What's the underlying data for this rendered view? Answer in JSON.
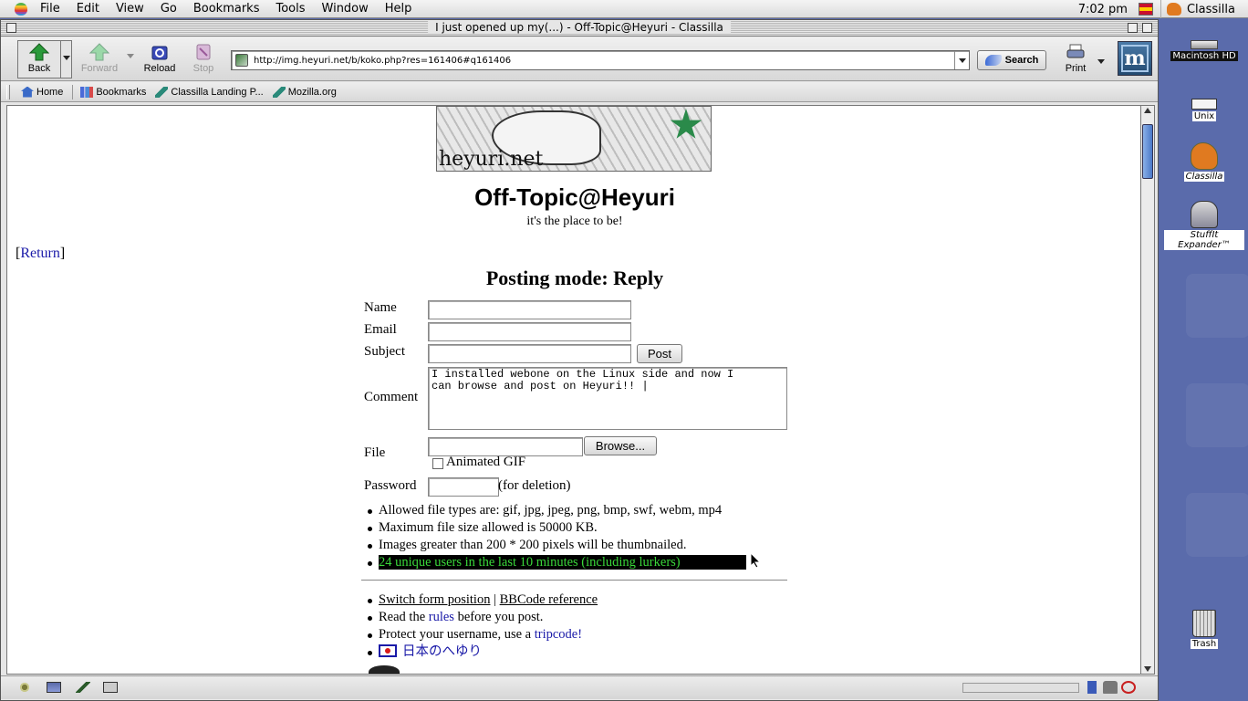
{
  "menubar": {
    "items": [
      "File",
      "Edit",
      "View",
      "Go",
      "Bookmarks",
      "Tools",
      "Window",
      "Help"
    ],
    "clock": "7:02 pm",
    "app_name": "Classilla"
  },
  "window": {
    "title": "I just opened up my(...) - Off-Topic@Heyuri - Classilla"
  },
  "toolbar": {
    "back": "Back",
    "forward": "Forward",
    "reload": "Reload",
    "stop": "Stop",
    "url": "http://img.heyuri.net/b/koko.php?res=161406#q161406",
    "search": "Search",
    "print": "Print",
    "throbber": "m"
  },
  "personal_bar": {
    "items": [
      "Home",
      "Bookmarks",
      "Classilla Landing P...",
      "Mozilla.org"
    ]
  },
  "page": {
    "banner_text": "heyuri.net",
    "board_title": "Off-Topic@Heyuri",
    "board_subtitle": "it's the place to be!",
    "return_link": "[Return]",
    "return_open": "[",
    "return_label": "Return",
    "return_close": "]",
    "posting_mode": "Posting mode: Reply",
    "form": {
      "name_label": "Name",
      "email_label": "Email",
      "subject_label": "Subject",
      "post_button": "Post",
      "comment_label": "Comment",
      "comment_value": "I installed webone on the Linux side and now I\ncan browse and post on Heyuri!! |",
      "file_label": "File",
      "browse_button": "Browse...",
      "animated_gif_label": "Animated GIF",
      "password_label": "Password",
      "deletion_note": "(for deletion)"
    },
    "rules": [
      "Allowed file types are: gif, jpg, jpeg, png, bmp, swf, webm, mp4",
      "Maximum file size allowed is 50000 KB.",
      "Images greater than 200 * 200 pixels will be thumbnailed.",
      "24 unique users in the last 10 minutes (including lurkers)"
    ],
    "links": {
      "switch_form": "Switch form position",
      "separator": "|",
      "bbcode": "BBCode reference",
      "read_the": "Read the",
      "rules": "rules",
      "before_post": "before you post.",
      "protect": "Protect your username, use a",
      "tripcode": "tripcode!",
      "japanese": "日本のへゆり"
    }
  },
  "desktop": {
    "icons": [
      "Macintosh HD",
      "Unix",
      "Classilla",
      "StuffIt Expander™",
      "Trash"
    ]
  }
}
